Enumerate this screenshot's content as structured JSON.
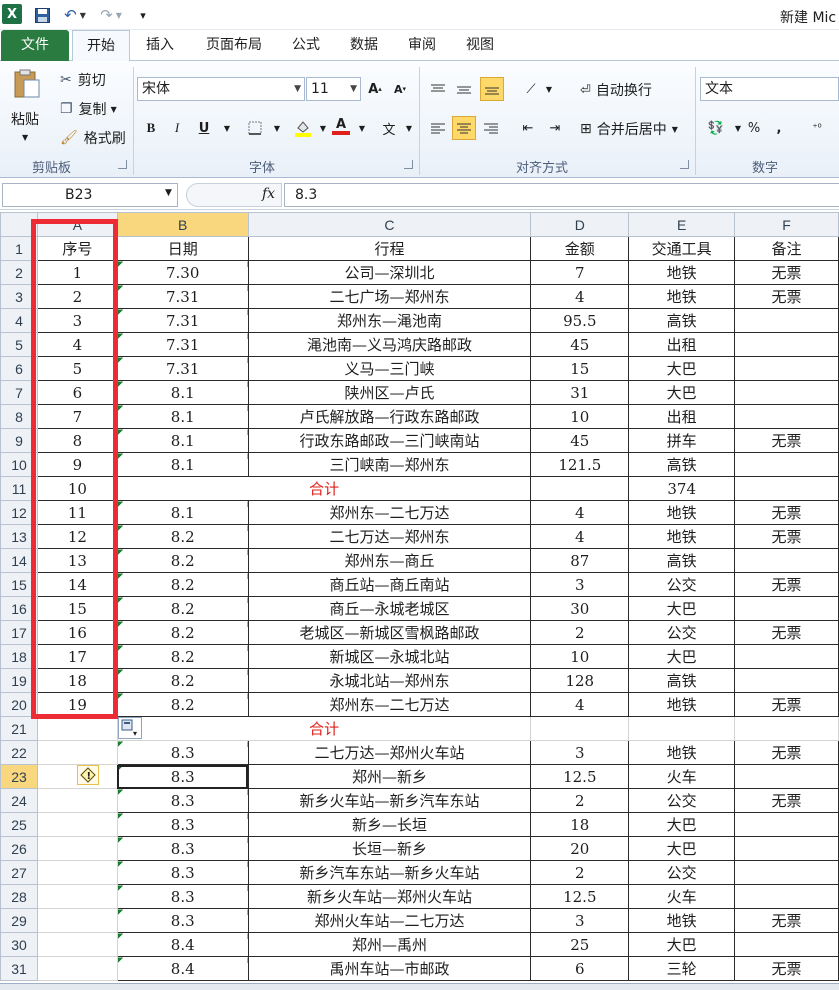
{
  "titlebar": {
    "app_icon": "X",
    "title": "新建 Mic"
  },
  "tabs": [
    "文件",
    "开始",
    "插入",
    "页面布局",
    "公式",
    "数据",
    "审阅",
    "视图"
  ],
  "ribbon": {
    "clipboard": {
      "paste": "粘贴",
      "cut": "剪切",
      "copy": "复制",
      "format_painter": "格式刷",
      "label": "剪贴板"
    },
    "font": {
      "name": "宋体",
      "size": "11",
      "label": "字体",
      "bold": "B",
      "italic": "I",
      "underline": "U",
      "wen": "文"
    },
    "alignment": {
      "wrap": "自动换行",
      "merge": "合并后居中",
      "label": "对齐方式"
    },
    "number": {
      "format": "文本",
      "percent": "%",
      "comma": ",",
      "label": "数字"
    }
  },
  "formula_bar": {
    "name_box": "B23",
    "fx": "fx",
    "value": "8.3"
  },
  "columns": [
    "A",
    "B",
    "C",
    "D",
    "E",
    "F"
  ],
  "rows": [
    [
      "序号",
      "日期",
      "行程",
      "金额",
      "交通工具",
      "备注"
    ],
    [
      "1",
      "7.30",
      "公司—深圳北",
      "7",
      "地铁",
      "无票"
    ],
    [
      "2",
      "7.31",
      "二七广场—郑州东",
      "4",
      "地铁",
      "无票"
    ],
    [
      "3",
      "7.31",
      "郑州东—渑池南",
      "95.5",
      "高铁",
      ""
    ],
    [
      "4",
      "7.31",
      "渑池南—义马鸿庆路邮政",
      "45",
      "出租",
      ""
    ],
    [
      "5",
      "7.31",
      "义马—三门峡",
      "15",
      "大巴",
      ""
    ],
    [
      "6",
      "8.1",
      "陕州区—卢氏",
      "31",
      "大巴",
      ""
    ],
    [
      "7",
      "8.1",
      "卢氏解放路—行政东路邮政",
      "10",
      "出租",
      ""
    ],
    [
      "8",
      "8.1",
      "行政东路邮政—三门峡南站",
      "45",
      "拼车",
      "无票"
    ],
    [
      "9",
      "8.1",
      "三门峡南—郑州东",
      "121.5",
      "高铁",
      ""
    ],
    [
      "10",
      "",
      "合计",
      "",
      "374",
      ""
    ],
    [
      "11",
      "8.1",
      "郑州东—二七万达",
      "4",
      "地铁",
      "无票"
    ],
    [
      "12",
      "8.2",
      "二七万达—郑州东",
      "4",
      "地铁",
      "无票"
    ],
    [
      "13",
      "8.2",
      "郑州东—商丘",
      "87",
      "高铁",
      ""
    ],
    [
      "14",
      "8.2",
      "商丘站—商丘南站",
      "3",
      "公交",
      "无票"
    ],
    [
      "15",
      "8.2",
      "商丘—永城老城区",
      "30",
      "大巴",
      ""
    ],
    [
      "16",
      "8.2",
      "老城区—新城区雪枫路邮政",
      "2",
      "公交",
      "无票"
    ],
    [
      "17",
      "8.2",
      "新城区—永城北站",
      "10",
      "大巴",
      ""
    ],
    [
      "18",
      "8.2",
      "永城北站—郑州东",
      "128",
      "高铁",
      ""
    ],
    [
      "19",
      "8.2",
      "郑州东—二七万达",
      "4",
      "地铁",
      "无票"
    ],
    [
      "",
      "",
      "合计",
      "",
      "",
      ""
    ],
    [
      "",
      "8.3",
      "二七万达—郑州火车站",
      "3",
      "地铁",
      "无票"
    ],
    [
      "",
      "8.3",
      "郑州—新乡",
      "12.5",
      "火车",
      ""
    ],
    [
      "",
      "8.3",
      "新乡火车站—新乡汽车东站",
      "2",
      "公交",
      "无票"
    ],
    [
      "",
      "8.3",
      "新乡—长垣",
      "18",
      "大巴",
      ""
    ],
    [
      "",
      "8.3",
      "长垣—新乡",
      "20",
      "大巴",
      ""
    ],
    [
      "",
      "8.3",
      "新乡汽车东站—新乡火车站",
      "2",
      "公交",
      ""
    ],
    [
      "",
      "8.3",
      "新乡火车站—郑州火车站",
      "12.5",
      "火车",
      ""
    ],
    [
      "",
      "8.3",
      "郑州火车站—二七万达",
      "3",
      "地铁",
      "无票"
    ],
    [
      "",
      "8.4",
      "郑州—禹州",
      "25",
      "大巴",
      ""
    ],
    [
      "",
      "8.4",
      "禹州车站—市邮政",
      "6",
      "三轮",
      "无票"
    ]
  ],
  "colors": {
    "accent_file": "#2a7b3f",
    "selection": "#f9d77e",
    "highlight": "#ec2b35",
    "total_text": "#e0211b"
  }
}
